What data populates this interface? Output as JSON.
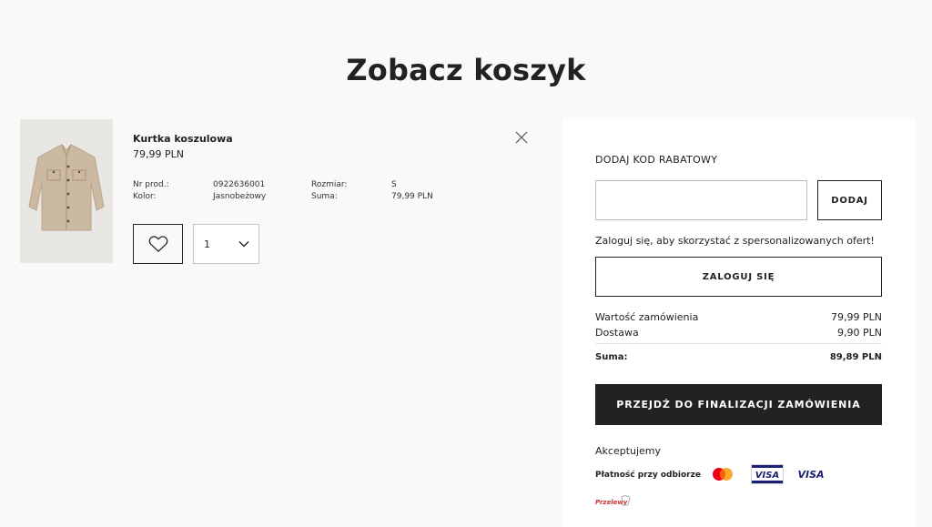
{
  "page": {
    "title": "Zobacz koszyk"
  },
  "product": {
    "name": "Kurtka koszulowa",
    "price": "79,99 PLN",
    "details": {
      "art_label": "Nr prod.:",
      "art_value": "0922636001",
      "size_label": "Rozmiar:",
      "size_value": "S",
      "color_label": "Kolor:",
      "color_value": "Jasnobeżowy",
      "total_label": "Suma:",
      "total_value": "79,99 PLN"
    },
    "quantity": "1",
    "icons": {
      "remove": "close-icon",
      "favorite": "heart-icon",
      "quantity": "chevron-down-icon"
    }
  },
  "summary": {
    "discount_heading": "DODAJ KOD RABATOWY",
    "discount_placeholder": "",
    "discount_button": "DODAJ",
    "login_hint": "Zaloguj się, aby skorzystać z spersonalizowanych ofert!",
    "login_button": "ZALOGUJ SIĘ",
    "order_value_label": "Wartość zamówienia",
    "order_value": "79,99 PLN",
    "delivery_label": "Dostawa",
    "delivery_value": "9,90 PLN",
    "total_label": "Suma:",
    "total_value": "89,89 PLN",
    "checkout_button": "PRZEJDŹ DO FINALIZACJI ZAMÓWIENIA",
    "accept_label": "Akceptujemy",
    "cod_label": "Płatność przy odbiorze",
    "payment_icons": [
      "mastercard-icon",
      "visa-electron-icon",
      "visa-icon",
      "przelewy24-icon"
    ],
    "payment_logo_text": {
      "visa": "VISA",
      "przelewy": "Przelewy"
    }
  },
  "colors": {
    "dark": "#222222",
    "background": "#faf9f8",
    "panel": "#ffffff",
    "jacket": "#cbb9a1",
    "visa_blue": "#1a1f71",
    "mastercard_red": "#eb001b",
    "mastercard_orange": "#f79e1b"
  }
}
